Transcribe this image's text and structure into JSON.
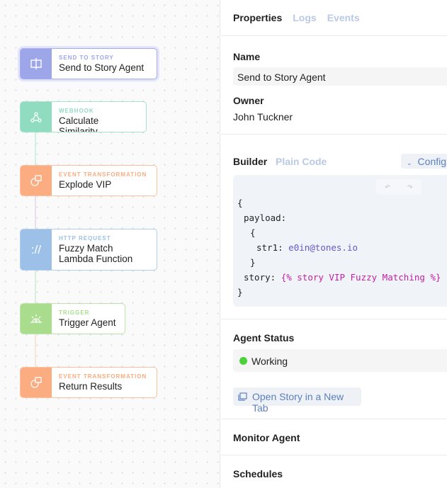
{
  "canvas": {
    "nodes": [
      {
        "type": "SEND TO STORY",
        "name": "Send to Story Agent",
        "icon": "send-to-story-icon",
        "color": "#9ea6ea"
      },
      {
        "type": "WEBHOOK",
        "name": "Calculate Similarity",
        "icon": "webhook-icon",
        "color": "#8fdcc0"
      },
      {
        "type": "EVENT TRANSFORMATION",
        "name": "Explode VIP",
        "icon": "transform-icon",
        "color": "#fbac80"
      },
      {
        "type": "HTTP REQUEST",
        "name": "Fuzzy Match Lambda Function",
        "icon": "http-icon",
        "color": "#9cc0e8"
      },
      {
        "type": "TRIGGER",
        "name": "Trigger Agent",
        "icon": "trigger-icon",
        "color": "#a9dc8c"
      },
      {
        "type": "EVENT TRANSFORMATION",
        "name": "Return Results",
        "icon": "transform-icon",
        "color": "#fbac80"
      }
    ],
    "http_glyph": "://"
  },
  "panel": {
    "tabs": [
      "Properties",
      "Logs",
      "Events"
    ],
    "name_label": "Name",
    "name_value": "Send to Story Agent",
    "owner_label": "Owner",
    "owner_value": "John Tuckner",
    "builder_tabs": [
      "Builder",
      "Plain Code"
    ],
    "config_label": "Config",
    "code": {
      "open": "{",
      "payload": "payload:",
      "inner_open": "{",
      "str1_key": "str1:",
      "str1_value": "e0in@tones.io",
      "inner_close": "}",
      "story_key": "story:",
      "story_value": "{% story VIP Fuzzy Matching %}",
      "close": "}"
    },
    "status_label": "Agent Status",
    "status_value": "Working",
    "status_color": "#4cd13c",
    "open_story": "Open Story in a New Tab",
    "monitor_label": "Monitor Agent",
    "schedules_label": "Schedules"
  }
}
